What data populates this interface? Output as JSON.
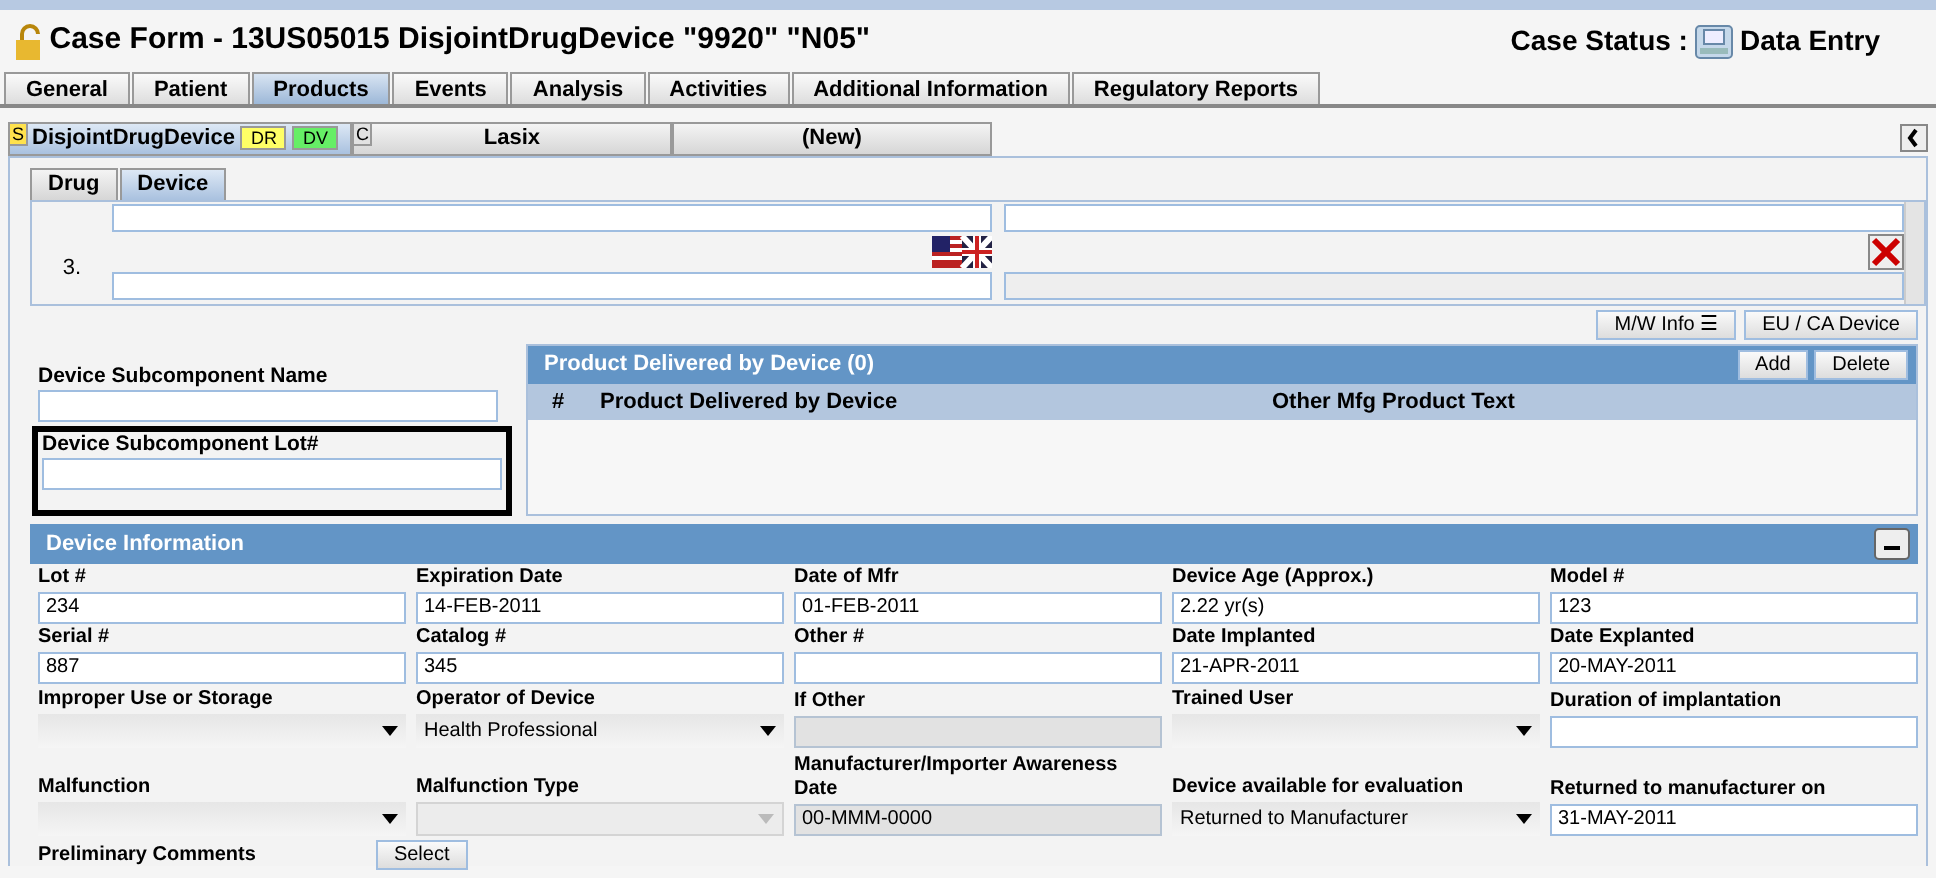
{
  "title": "Case Form - 13US05015 DisjointDrugDevice \"9920\" \"N05\"",
  "case_status": {
    "label": "Case Status :",
    "value": "Data Entry"
  },
  "main_tabs": [
    {
      "label": "General",
      "selected": false
    },
    {
      "label": "Patient",
      "selected": false
    },
    {
      "label": "Products",
      "selected": true
    },
    {
      "label": "Events",
      "selected": false
    },
    {
      "label": "Analysis",
      "selected": false
    },
    {
      "label": "Activities",
      "selected": false
    },
    {
      "label": "Additional Information",
      "selected": false
    },
    {
      "label": "Regulatory Reports",
      "selected": false
    }
  ],
  "product_tabs": [
    {
      "label": "DisjointDrugDevice",
      "marker": "S",
      "selected": true,
      "badges": [
        {
          "label": "DR",
          "color": "#ffff66"
        },
        {
          "label": "DV",
          "color": "#66ee66"
        }
      ]
    },
    {
      "label": "Lasix",
      "marker": "C",
      "selected": false
    },
    {
      "label": "(New)",
      "selected": false
    }
  ],
  "sub_tabs": [
    {
      "label": "Drug",
      "selected": false
    },
    {
      "label": "Device",
      "selected": true
    }
  ],
  "device_rows": [
    {
      "number": "3."
    }
  ],
  "buttons": [
    "M/W Info ☰",
    "EU / CA Device"
  ],
  "subcomponent_fields": [
    {
      "label": "Device Subcomponent Name",
      "highlighted": false
    },
    {
      "label": "Device Subcomponent Lot#",
      "highlighted": true
    }
  ],
  "product_delivered": {
    "title": "Product Delivered by Device (0)",
    "buttons": [
      "Add",
      "Delete"
    ],
    "columns": [
      "#",
      "Product Delivered by Device",
      "Other Mfg Product Text"
    ]
  },
  "device_information": {
    "title": "Device Information",
    "fields": [
      {
        "label": "Lot #",
        "kind": "text",
        "value": "234",
        "disabled": false
      },
      {
        "label": "Expiration Date",
        "kind": "text",
        "value": "14-FEB-2011",
        "disabled": false
      },
      {
        "label": "Date of Mfr",
        "kind": "text",
        "value": "01-FEB-2011",
        "disabled": false
      },
      {
        "label": "Device Age (Approx.)",
        "kind": "text",
        "value": "2.22 yr(s)",
        "disabled": false
      },
      {
        "label": "Model #",
        "kind": "text",
        "value": "123",
        "disabled": false
      },
      {
        "label": "Serial #",
        "kind": "text",
        "value": "887",
        "disabled": false
      },
      {
        "label": "Catalog #",
        "kind": "text",
        "value": "345",
        "disabled": false
      },
      {
        "label": "Other #",
        "kind": "text",
        "disabled": false
      },
      {
        "label": "Date Implanted",
        "kind": "text",
        "value": "21-APR-2011",
        "disabled": false
      },
      {
        "label": "Date Explanted",
        "kind": "text",
        "value": "20-MAY-2011",
        "disabled": false
      },
      {
        "label": "Improper Use or Storage",
        "kind": "select",
        "disabled": false
      },
      {
        "label": "Operator of Device",
        "kind": "select",
        "value": "Health Professional",
        "disabled": false
      },
      {
        "label": "If Other",
        "kind": "text",
        "disabled": true
      },
      {
        "label": "Trained User",
        "kind": "select",
        "disabled": false
      },
      {
        "label": "Duration of implantation",
        "kind": "text",
        "disabled": false
      },
      {
        "label": "Malfunction",
        "kind": "select",
        "disabled": false
      },
      {
        "label": "Malfunction Type",
        "kind": "select",
        "disabled": true
      },
      {
        "label": "Manufacturer/Importer Awareness Date",
        "kind": "text",
        "value": "00-MMM-0000",
        "disabled": true
      },
      {
        "label": "Device available for evaluation",
        "kind": "select",
        "value": "Returned to Manufacturer",
        "disabled": false
      },
      {
        "label": "Returned to manufacturer on",
        "kind": "text",
        "value": "31-MAY-2011",
        "disabled": false
      }
    ],
    "comments": {
      "label": "Preliminary Comments",
      "button": "Select"
    }
  }
}
